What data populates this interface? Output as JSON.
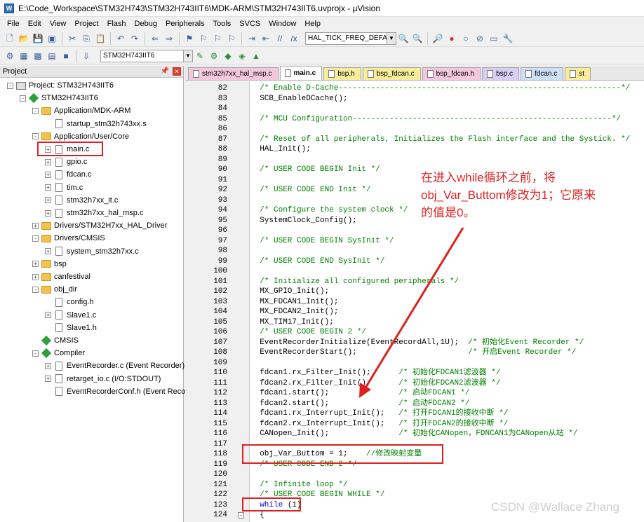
{
  "window": {
    "title": "E:\\Code_Workspace\\STM32H743\\STM32H743IIT6\\MDK-ARM\\STM32H743IIT6.uvprojx - µVision"
  },
  "menu": [
    "File",
    "Edit",
    "View",
    "Project",
    "Flash",
    "Debug",
    "Peripherals",
    "Tools",
    "SVCS",
    "Window",
    "Help"
  ],
  "toolbar": {
    "define_combo": "HAL_TICK_FREQ_DEFAULT",
    "target_combo": "STM32H743IIT6",
    "icons1": [
      "new-file-icon",
      "open-icon",
      "save-icon",
      "save-all-icon",
      "cut-icon",
      "copy-icon",
      "paste-icon",
      "undo-icon",
      "redo-icon",
      "back-icon",
      "forward-icon",
      "bookmark-icon",
      "prev-bookmark-icon",
      "next-bookmark-icon",
      "clear-bookmarks-icon",
      "indent-icon",
      "unindent-icon",
      "comment-icon",
      "uncomment-icon"
    ],
    "icons2": [
      "translate-icon",
      "build-icon",
      "rebuild-icon",
      "batch-build-icon",
      "stop-build-icon",
      "download-icon"
    ]
  },
  "project": {
    "title": "Project",
    "nodes": [
      {
        "label": "Project: STM32H743IIT6",
        "type": "proj",
        "depth": 0,
        "exp": "-"
      },
      {
        "label": "STM32H743IIT6",
        "type": "diamond",
        "depth": 1,
        "exp": "-"
      },
      {
        "label": "Application/MDK-ARM",
        "type": "folder",
        "depth": 2,
        "exp": "-"
      },
      {
        "label": "startup_stm32h743xx.s",
        "type": "file",
        "depth": 3,
        "exp": ""
      },
      {
        "label": "Application/User/Core",
        "type": "folder",
        "depth": 2,
        "exp": "-"
      },
      {
        "label": "main.c",
        "type": "file",
        "depth": 3,
        "exp": "+"
      },
      {
        "label": "gpio.c",
        "type": "file",
        "depth": 3,
        "exp": "+"
      },
      {
        "label": "fdcan.c",
        "type": "file",
        "depth": 3,
        "exp": "+"
      },
      {
        "label": "tim.c",
        "type": "file",
        "depth": 3,
        "exp": "+"
      },
      {
        "label": "stm32h7xx_it.c",
        "type": "file",
        "depth": 3,
        "exp": "+"
      },
      {
        "label": "stm32h7xx_hal_msp.c",
        "type": "file",
        "depth": 3,
        "exp": "+"
      },
      {
        "label": "Drivers/STM32H7xx_HAL_Driver",
        "type": "folder",
        "depth": 2,
        "exp": "+"
      },
      {
        "label": "Drivers/CMSIS",
        "type": "folder",
        "depth": 2,
        "exp": "-"
      },
      {
        "label": "system_stm32h7xx.c",
        "type": "file",
        "depth": 3,
        "exp": "+"
      },
      {
        "label": "bsp",
        "type": "folder",
        "depth": 2,
        "exp": "+"
      },
      {
        "label": "canfestival",
        "type": "folder",
        "depth": 2,
        "exp": "+"
      },
      {
        "label": "obj_dir",
        "type": "folder",
        "depth": 2,
        "exp": "-"
      },
      {
        "label": "config.h",
        "type": "file",
        "depth": 3,
        "exp": ""
      },
      {
        "label": "Slave1.c",
        "type": "file",
        "depth": 3,
        "exp": "+"
      },
      {
        "label": "Slave1.h",
        "type": "file",
        "depth": 3,
        "exp": ""
      },
      {
        "label": "CMSIS",
        "type": "diamond",
        "depth": 2,
        "exp": ""
      },
      {
        "label": "Compiler",
        "type": "diamond",
        "depth": 2,
        "exp": "-"
      },
      {
        "label": "EventRecorder.c (Event Recorder)",
        "type": "file",
        "depth": 3,
        "exp": "+"
      },
      {
        "label": "retarget_io.c (I/O:STDOUT)",
        "type": "file",
        "depth": 3,
        "exp": "+"
      },
      {
        "label": "EventRecorderConf.h (Event Reco",
        "type": "file",
        "depth": 3,
        "exp": ""
      }
    ]
  },
  "tabs": [
    {
      "label": "stm32h7xx_hal_msp.c",
      "color": "pink"
    },
    {
      "label": "main.c",
      "color": "pink",
      "active": true
    },
    {
      "label": "bsp.h",
      "color": "yellow"
    },
    {
      "label": "bsp_fdcan.c",
      "color": "yellow"
    },
    {
      "label": "bsp_fdcan.h",
      "color": "pink"
    },
    {
      "label": "bsp.c",
      "color": "purple"
    },
    {
      "label": "fdcan.c",
      "color": "blue"
    },
    {
      "label": "st",
      "color": "yellow"
    }
  ],
  "code": [
    {
      "n": "82",
      "t": "  /* Enable D-Cache-------------------------------------------------------------*/",
      "k": "com"
    },
    {
      "n": "83",
      "t": "  SCB_EnableDCache();",
      "k": "code"
    },
    {
      "n": "84",
      "t": "",
      "k": "code"
    },
    {
      "n": "85",
      "t": "  /* MCU Configuration--------------------------------------------------------*/",
      "k": "com"
    },
    {
      "n": "86",
      "t": "",
      "k": "code"
    },
    {
      "n": "87",
      "t": "  /* Reset of all peripherals, Initializes the Flash interface and the Systick. */",
      "k": "com"
    },
    {
      "n": "88",
      "t": "  HAL_Init();",
      "k": "code"
    },
    {
      "n": "89",
      "t": "",
      "k": "code"
    },
    {
      "n": "90",
      "t": "  /* USER CODE BEGIN Init */",
      "k": "com"
    },
    {
      "n": "91",
      "t": "",
      "k": "code"
    },
    {
      "n": "92",
      "t": "  /* USER CODE END Init */",
      "k": "com"
    },
    {
      "n": "93",
      "t": "",
      "k": "code"
    },
    {
      "n": "94",
      "t": "  /* Configure the system clock */",
      "k": "com"
    },
    {
      "n": "95",
      "t": "  SystemClock_Config();",
      "k": "code"
    },
    {
      "n": "96",
      "t": "",
      "k": "code"
    },
    {
      "n": "97",
      "t": "  /* USER CODE BEGIN SysInit */",
      "k": "com"
    },
    {
      "n": "98",
      "t": "",
      "k": "code"
    },
    {
      "n": "99",
      "t": "  /* USER CODE END SysInit */",
      "k": "com"
    },
    {
      "n": "100",
      "t": "",
      "k": "code"
    },
    {
      "n": "101",
      "t": "  /* Initialize all configured peripherals */",
      "k": "com"
    },
    {
      "n": "102",
      "t": "  MX_GPIO_Init();",
      "k": "code"
    },
    {
      "n": "103",
      "t": "  MX_FDCAN1_Init();",
      "k": "code"
    },
    {
      "n": "104",
      "t": "  MX_FDCAN2_Init();",
      "k": "code"
    },
    {
      "n": "105",
      "t": "  MX_TIM17_Init();",
      "k": "code"
    },
    {
      "n": "106",
      "t": "  /* USER CODE BEGIN 2 */",
      "k": "com"
    },
    {
      "n": "107",
      "t": "  EventRecorderInitialize(EventRecordAll,1U);  /* 初始化Event Recorder */",
      "k": "mix",
      "split": 46
    },
    {
      "n": "108",
      "t": "  EventRecorderStart();                        /* 开启Event Recorder */",
      "k": "mix",
      "split": 46
    },
    {
      "n": "109",
      "t": "",
      "k": "code"
    },
    {
      "n": "110",
      "t": "  fdcan1.rx_Filter_Init();      /* 初始化FDCAN1滤波器 */",
      "k": "mix",
      "split": 32
    },
    {
      "n": "111",
      "t": "  fdcan2.rx_Filter_Init();      /* 初始化FDCAN2滤波器 */",
      "k": "mix",
      "split": 32
    },
    {
      "n": "112",
      "t": "  fdcan1.start();               /* 启动FDCAN1 */",
      "k": "mix",
      "split": 32
    },
    {
      "n": "113",
      "t": "  fdcan2.start();               /* 启动FDCAN2 */",
      "k": "mix",
      "split": 32
    },
    {
      "n": "114",
      "t": "  fdcan1.rx_Interrupt_Init();   /* 打开FDCAN1的接收中断 */",
      "k": "mix",
      "split": 32
    },
    {
      "n": "115",
      "t": "  fdcan2.rx_Interrupt_Init();   /* 打开FDCAN2的接收中断 */",
      "k": "mix",
      "split": 32
    },
    {
      "n": "116",
      "t": "  CANopen_Init();               /* 初始化CANopen，FDNCAN1为CANopen从站 */",
      "k": "mix",
      "split": 32
    },
    {
      "n": "117",
      "t": "",
      "k": "code"
    },
    {
      "n": "118",
      "t": "  obj_Var_Buttom = 1;    //修改映射变量",
      "k": "mix",
      "split": 25
    },
    {
      "n": "119",
      "t": "  /* USER CODE END 2 */",
      "k": "com"
    },
    {
      "n": "120",
      "t": "",
      "k": "code"
    },
    {
      "n": "121",
      "t": "  /* Infinite loop */",
      "k": "com"
    },
    {
      "n": "122",
      "t": "  /* USER CODE BEGIN WHILE */",
      "k": "com"
    },
    {
      "n": "123",
      "t": "  while (1)",
      "k": "while"
    },
    {
      "n": "124",
      "t": "  {",
      "k": "code"
    }
  ],
  "annotation": {
    "lines": [
      "在进入while循环之前，将",
      "obj_Var_Buttom修改为1；它原来",
      "的值是0。"
    ],
    "color": "#e02020"
  },
  "watermark": "CSDN @Wallace Zhang"
}
